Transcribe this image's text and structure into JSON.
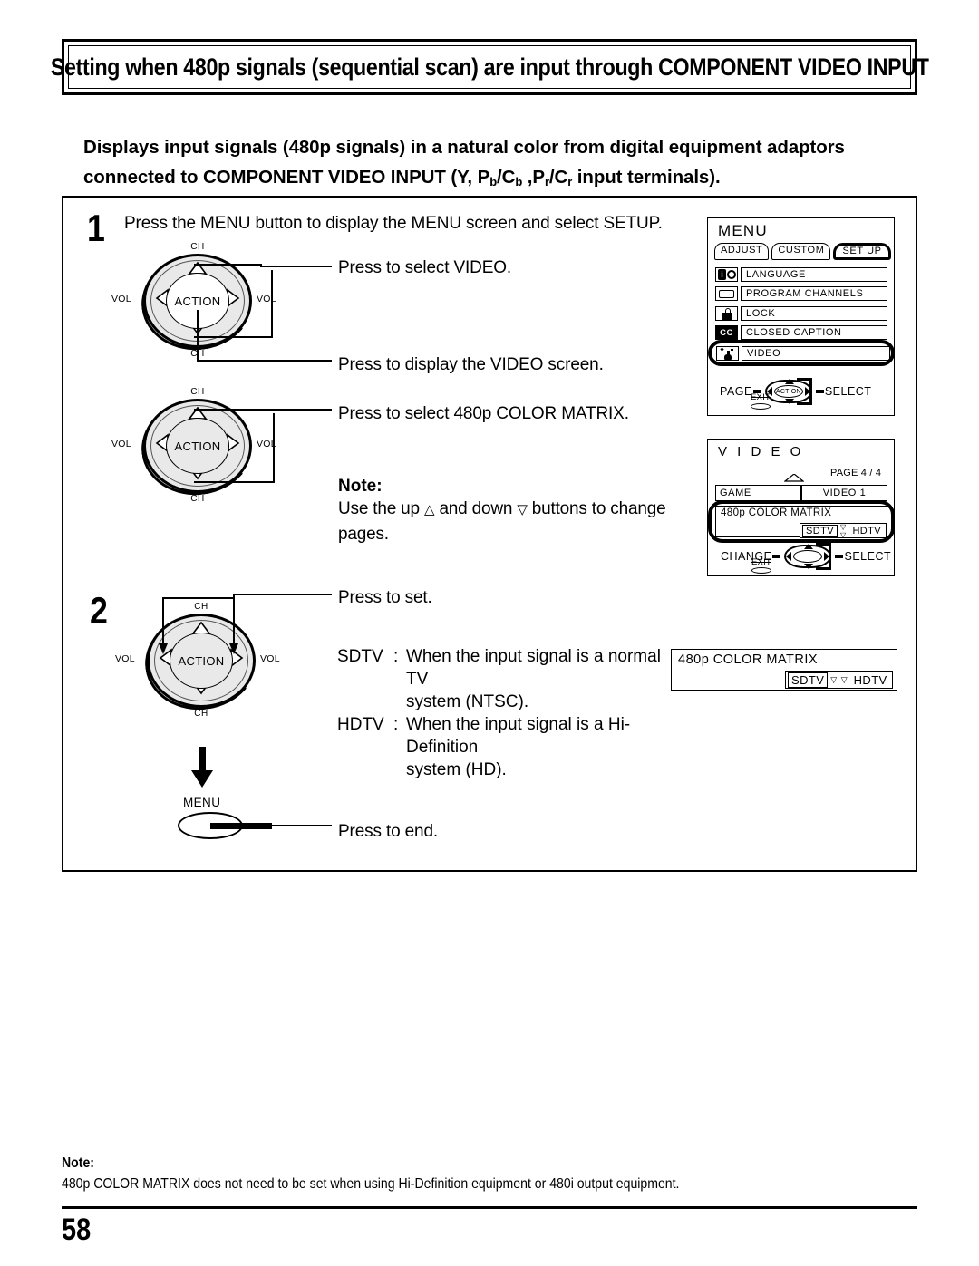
{
  "page": {
    "number": "58",
    "title": "Setting when 480p signals (sequential scan) are input through COMPONENT VIDEO INPUT",
    "subtitle_line1": "Displays input signals (480p signals) in a natural color from digital equipment adaptors",
    "subtitle_line2_a": "connected to COMPONENT VIDEO INPUT (Y, P",
    "subtitle_line2_sub1": "b",
    "subtitle_line2_b": "/C",
    "subtitle_line2_sub2": "b",
    "subtitle_line2_c": " ,P",
    "subtitle_line2_sub3": "r",
    "subtitle_line2_d": "/C",
    "subtitle_line2_sub4": "r",
    "subtitle_line2_e": " input terminals)."
  },
  "steps": {
    "one": {
      "number": "1",
      "instruction": "Press the MENU button to display the MENU screen and select SETUP.",
      "callout_select_video": "Press to select VIDEO.",
      "callout_display_video": "Press to display the VIDEO screen.",
      "callout_select_matrix": "Press to select 480p COLOR MATRIX."
    },
    "two": {
      "number": "2",
      "callout_press_set": "Press to set.",
      "callout_press_end": "Press to end."
    }
  },
  "note_mid": {
    "label": "Note:",
    "line1_a": "Use the up",
    "up_glyph": "△",
    "line1_b": "and down",
    "down_glyph": "▽",
    "line1_c": "buttons to change",
    "line2": "pages."
  },
  "definitions": [
    {
      "key": "SDTV",
      "colon": ":",
      "text": "When the input signal is a normal TV",
      "cont": "system (NTSC)."
    },
    {
      "key": "HDTV",
      "colon": ":",
      "text": "When the input signal is a Hi-Definition",
      "cont": "system (HD)."
    }
  ],
  "remote_dials": [
    {
      "action_label": "ACTION",
      "ch_top": "CH",
      "ch_bottom": "CH",
      "vol_left": "VOL",
      "vol_right": "VOL"
    },
    {
      "action_label": "ACTION",
      "ch_top": "CH",
      "ch_bottom": "CH",
      "vol_left": "VOL",
      "vol_right": "VOL"
    },
    {
      "action_label": "ACTION",
      "ch_top": "CH",
      "ch_bottom": "CH",
      "vol_left": "VOL",
      "vol_right": "VOL"
    }
  ],
  "menu_button": {
    "label": "MENU"
  },
  "osd_menu": {
    "title": "MENU",
    "tabs": [
      {
        "label": "ADJUST",
        "selected": false
      },
      {
        "label": "CUSTOM",
        "selected": false
      },
      {
        "label": "SET  UP",
        "selected": true
      }
    ],
    "items": [
      {
        "label": "LANGUAGE",
        "icon": "language-icon",
        "highlighted": false
      },
      {
        "label": "PROGRAM  CHANNELS",
        "icon": "tv-screen-icon",
        "highlighted": false
      },
      {
        "label": "LOCK",
        "icon": "padlock-icon",
        "highlighted": false
      },
      {
        "label": "CLOSED  CAPTION",
        "icon": "closed-caption-icon",
        "highlighted": false
      },
      {
        "label": "VIDEO",
        "icon": "hand-pointer-icon",
        "highlighted": true
      }
    ],
    "nav": {
      "left_label": "PAGE",
      "right_label": "SELECT",
      "hub_label": "ACTION",
      "exit_label": "EXIT"
    }
  },
  "osd_video": {
    "title": "V I D E O",
    "page_indicator": "PAGE 4 / 4",
    "row_left": "GAME",
    "row_right": "VIDEO 1",
    "matrix_label": "480p  COLOR MATRIX",
    "option_selected": "SDTV",
    "option_arrows": "▽ ▽",
    "option_other": "HDTV",
    "nav": {
      "left_label": "CHANGE",
      "right_label": "SELECT",
      "hub_label": "",
      "exit_label": "EXIT"
    }
  },
  "osd_matrix_panel": {
    "matrix_label": "480p  COLOR MATRIX",
    "option_selected": "SDTV",
    "option_arrows": "▽ ▽",
    "option_other": "HDTV"
  },
  "bottom_note": {
    "label": "Note:",
    "text": "480p COLOR MATRIX does not need to be set when using Hi-Definition equipment or 480i output equipment."
  },
  "colors": {
    "ink": "#000000",
    "paper": "#ffffff",
    "dial_fill": "#e9e9e9"
  }
}
